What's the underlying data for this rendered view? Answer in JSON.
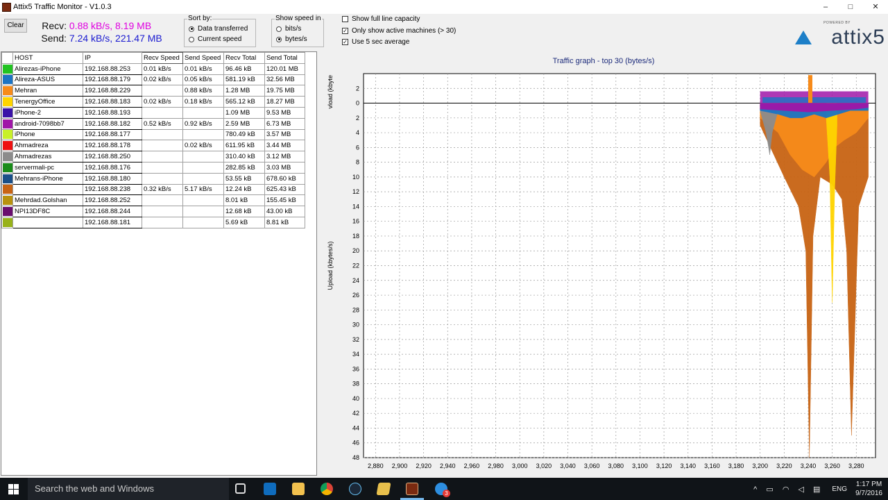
{
  "window": {
    "title": "Attix5 Traffic Monitor - V1.0.3",
    "controls": [
      "–",
      "□",
      "✕"
    ]
  },
  "toolbar": {
    "clear_label": "Clear",
    "recv_label": "Recv:",
    "recv_value": "0.88 kB/s, 8.19 MB",
    "send_label": "Send:",
    "send_value": "7.24 kB/s, 221.47 MB",
    "recv_color": "#e000e0",
    "send_color": "#1a1ad0"
  },
  "sort_by": {
    "legend": "Sort by:",
    "options": [
      "Data transferred",
      "Current speed"
    ],
    "selected": "Data transferred"
  },
  "show_speed": {
    "legend": "Show speed in",
    "options": [
      "bits/s",
      "bytes/s"
    ],
    "selected": "bytes/s"
  },
  "options": {
    "full_line": {
      "label": "Show full line capacity",
      "checked": false
    },
    "active_only": {
      "label": "Only show active machines (> 30)",
      "checked": true
    },
    "avg5": {
      "label": "Use 5 sec average",
      "checked": true
    }
  },
  "logo": {
    "powered": "POWERED BY",
    "text": "attix5"
  },
  "table": {
    "headers": [
      "HOST",
      "IP",
      "Recv Speed",
      "Send Speed",
      "Recv Total",
      "Send Total"
    ],
    "rows": [
      {
        "color": "#22c322",
        "host": "Alirezas-iPhone",
        "ip": "192.168.88.253",
        "recv_speed": "0.01 kB/s",
        "send_speed": "0.01 kB/s",
        "recv_total": "96.46 kB",
        "send_total": "120.01 MB"
      },
      {
        "color": "#1c74c4",
        "host": "Alireza-ASUS",
        "ip": "192.168.88.179",
        "recv_speed": "0.02 kB/s",
        "send_speed": "0.05 kB/s",
        "recv_total": "581.19 kB",
        "send_total": "32.56 MB"
      },
      {
        "color": "#f78b1a",
        "host": "Mehran",
        "ip": "192.168.88.229",
        "recv_speed": "",
        "send_speed": "0.88 kB/s",
        "recv_total": "1.28 MB",
        "send_total": "19.75 MB"
      },
      {
        "color": "#ffd400",
        "host": "TenergyOffice",
        "ip": "192.168.88.183",
        "recv_speed": "0.02 kB/s",
        "send_speed": "0.18 kB/s",
        "recv_total": "565.12 kB",
        "send_total": "18.27 MB"
      },
      {
        "color": "#3a12a8",
        "host": "iPhone-2",
        "ip": "192.168.88.193",
        "recv_speed": "",
        "send_speed": "",
        "recv_total": "1.09 MB",
        "send_total": "9.53 MB"
      },
      {
        "color": "#a016a8",
        "host": "android-7098bb7",
        "ip": "192.168.88.182",
        "recv_speed": "0.52 kB/s",
        "send_speed": "0.92 kB/s",
        "recv_total": "2.59 MB",
        "send_total": "6.73 MB"
      },
      {
        "color": "#c8f02a",
        "host": "iPhone",
        "ip": "192.168.88.177",
        "recv_speed": "",
        "send_speed": "",
        "recv_total": "780.49 kB",
        "send_total": "3.57 MB"
      },
      {
        "color": "#ee1111",
        "host": "Ahmadreza",
        "ip": "192.168.88.178",
        "recv_speed": "",
        "send_speed": "0.02 kB/s",
        "recv_total": "611.95 kB",
        "send_total": "3.44 MB"
      },
      {
        "color": "#8c8c8c",
        "host": "Ahmadrezas",
        "ip": "192.168.88.250",
        "recv_speed": "",
        "send_speed": "",
        "recv_total": "310.40 kB",
        "send_total": "3.12 MB"
      },
      {
        "color": "#1a8c1a",
        "host": "servermali-pc",
        "ip": "192.168.88.176",
        "recv_speed": "",
        "send_speed": "",
        "recv_total": "282.85 kB",
        "send_total": "3.03 MB"
      },
      {
        "color": "#1a4f88",
        "host": "Mehrans-iPhone",
        "ip": "192.168.88.180",
        "recv_speed": "",
        "send_speed": "",
        "recv_total": "53.55 kB",
        "send_total": "678.60 kB"
      },
      {
        "color": "#c86414",
        "host": "",
        "ip": "192.168.88.238",
        "recv_speed": "0.32 kB/s",
        "send_speed": "5.17 kB/s",
        "recv_total": "12.24 kB",
        "send_total": "625.43 kB"
      },
      {
        "color": "#b8920e",
        "host": "Mehrdad.Golshan",
        "ip": "192.168.88.252",
        "recv_speed": "",
        "send_speed": "",
        "recv_total": "8.01 kB",
        "send_total": "155.45 kB"
      },
      {
        "color": "#6a0e6e",
        "host": "NPI13DF8C",
        "ip": "192.168.88.244",
        "recv_speed": "",
        "send_speed": "",
        "recv_total": "12.68 kB",
        "send_total": "43.00 kB"
      },
      {
        "color": "#98b21a",
        "host": "",
        "ip": "192.168.88.181",
        "recv_speed": "",
        "send_speed": "",
        "recv_total": "5.69 kB",
        "send_total": "8.81 kB"
      }
    ]
  },
  "graph": {
    "title": "Traffic graph - top 30 (bytes/s)",
    "upper_axis_label": "vload (kbyte",
    "lower_axis_label": "Upload (kbytes/s)",
    "y_top_ticks": [
      2,
      0
    ],
    "y_bottom_ticks": [
      2,
      4,
      6,
      8,
      10,
      12,
      14,
      16,
      18,
      20,
      22,
      24,
      26,
      28,
      30,
      32,
      34,
      36,
      38,
      40,
      42,
      44,
      46,
      48
    ],
    "x_ticks": [
      "2,880",
      "2,900",
      "2,920",
      "2,940",
      "2,960",
      "2,980",
      "3,000",
      "3,020",
      "3,040",
      "3,060",
      "3,080",
      "3,100",
      "3,120",
      "3,140",
      "3,160",
      "3,180",
      "3,200",
      "3,220",
      "3,240",
      "3,260",
      "3,280"
    ]
  },
  "chart_data": {
    "type": "area",
    "title": "Traffic graph - top 30 (bytes/s)",
    "xlabel": "",
    "ylabel": "Upload (kbytes/s)",
    "xlim": [
      2870,
      3296
    ],
    "ylim": [
      -4,
      48
    ],
    "grid": true,
    "series": [
      {
        "name": "",
        "color": "#c86414",
        "x": [
          3200,
          3220,
          3232,
          3238,
          3241,
          3244,
          3250,
          3260,
          3268,
          3272,
          3276,
          3282,
          3290
        ],
        "values": [
          3,
          10,
          14,
          20,
          48,
          18,
          10,
          11,
          13,
          20,
          45,
          14,
          10
        ]
      },
      {
        "name": "Mehran",
        "color": "#f78b1a",
        "x": [
          3200,
          3215,
          3225,
          3235,
          3245,
          3255,
          3262,
          3270,
          3280,
          3290
        ],
        "values": [
          2,
          4,
          7,
          9,
          10,
          8,
          6,
          5,
          4,
          2
        ]
      },
      {
        "name": "TenergyOffice",
        "color": "#ffd400",
        "x": [
          3255,
          3258,
          3260,
          3262,
          3264
        ],
        "values": [
          2,
          10,
          27,
          12,
          3
        ]
      },
      {
        "name": "Ahmadrezas",
        "color": "#8c8c8c",
        "x": [
          3200,
          3205,
          3208,
          3210,
          3215
        ],
        "values": [
          1,
          4,
          7,
          4,
          1
        ]
      },
      {
        "name": "Alireza-ASUS",
        "color": "#1c74c4",
        "x": [
          3200,
          3215,
          3225,
          3235,
          3245,
          3255,
          3265,
          3275,
          3290
        ],
        "values": [
          1,
          1.5,
          2,
          2,
          1.5,
          2,
          1.5,
          1,
          1
        ]
      },
      {
        "name": "android-7098bb7",
        "color": "#a016a8",
        "x": [
          3200,
          3220,
          3240,
          3260,
          3280,
          3290
        ],
        "values": [
          0.8,
          1,
          1.2,
          1,
          0.8,
          0.6
        ]
      }
    ]
  },
  "taskbar": {
    "search_placeholder": "Search the web and Windows",
    "language": "ENG",
    "time": "1:17 PM",
    "date": "9/7/2016",
    "badge": "3"
  }
}
